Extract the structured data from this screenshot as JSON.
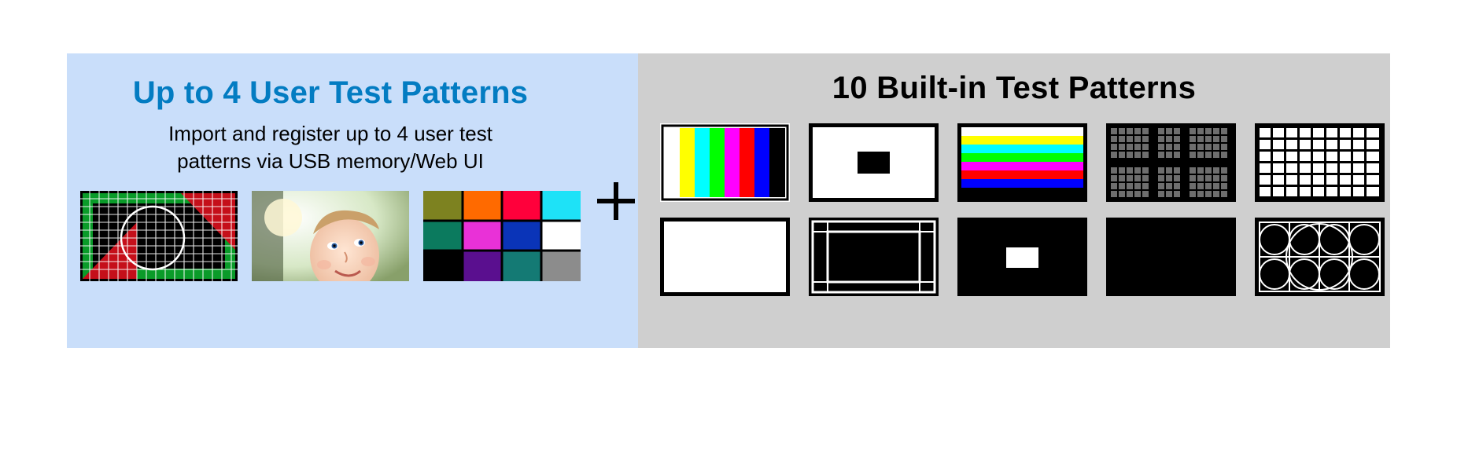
{
  "left": {
    "title": "Up to 4 User Test Patterns",
    "subtitle": "Import and register up to 4 user test\npatterns via USB memory/Web UI",
    "thumbs": [
      {
        "name": "user-pattern-grid-circle"
      },
      {
        "name": "user-pattern-photo"
      },
      {
        "name": "user-pattern-color-chart"
      }
    ]
  },
  "plus_label": "+",
  "right": {
    "title": "10 Built-in Test Patterns",
    "tiles": [
      {
        "name": "color-bars"
      },
      {
        "name": "white-black-rect"
      },
      {
        "name": "horizontal-color-bars"
      },
      {
        "name": "checker-fine"
      },
      {
        "name": "checker-coarse"
      },
      {
        "name": "full-white"
      },
      {
        "name": "safe-area-outline"
      },
      {
        "name": "black-white-rect"
      },
      {
        "name": "full-black"
      },
      {
        "name": "hatch-circles"
      }
    ]
  }
}
